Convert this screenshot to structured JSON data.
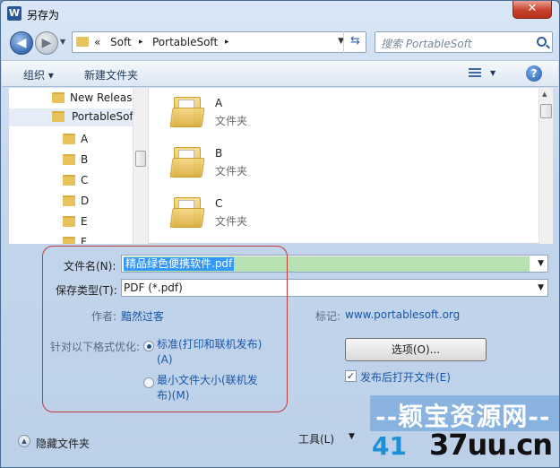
{
  "window": {
    "title": "另存为",
    "app_icon": "W",
    "close_glyph": "✕"
  },
  "address_bar": {
    "path": [
      "«",
      "Soft",
      "PortableSoft"
    ],
    "separator": "▸"
  },
  "search": {
    "placeholder": "搜索 PortableSoft"
  },
  "toolbar": {
    "organize": "组织 ▾",
    "new_folder": "新建文件夹"
  },
  "nav_tree": [
    {
      "label": "New Releas",
      "selected": false
    },
    {
      "label": "PortableSof",
      "selected": true
    },
    {
      "label": "A"
    },
    {
      "label": "B"
    },
    {
      "label": "C"
    },
    {
      "label": "D"
    },
    {
      "label": "E"
    },
    {
      "label": "F"
    }
  ],
  "files": [
    {
      "name": "A",
      "type": "文件夹"
    },
    {
      "name": "B",
      "type": "文件夹"
    },
    {
      "name": "C",
      "type": "文件夹"
    }
  ],
  "form": {
    "filename_label": "文件名(N):",
    "filename_value": "精品绿色便携软件.pdf",
    "filetype_label": "保存类型(T):",
    "filetype_value": "PDF (*.pdf)",
    "author_label": "作者:",
    "author_value": "黯然过客",
    "tags_label": "标记:",
    "tags_value": "www.portablesoft.org",
    "optimize_label": "针对以下格式优化:",
    "opt_standard_line1": "标准(打印和联机发布)",
    "opt_standard_line2": "(A)",
    "opt_min_line1": "最小文件大小(联机发",
    "opt_min_line2": "布)(M)",
    "options_button": "选项(O)...",
    "open_after": "发布后打开文件(E)",
    "open_after_checked": true,
    "selected_option": "standard"
  },
  "footer": {
    "hide_folders": "隐藏文件夹",
    "tools": "工具(L)"
  },
  "watermark": {
    "cn": "--颖宝资源网--",
    "num": "41",
    "domain": "37uu.cn"
  },
  "colors": {
    "accent": "#1a57a6",
    "highlight_box": "#c23b3b",
    "selection": "#3399ff"
  }
}
